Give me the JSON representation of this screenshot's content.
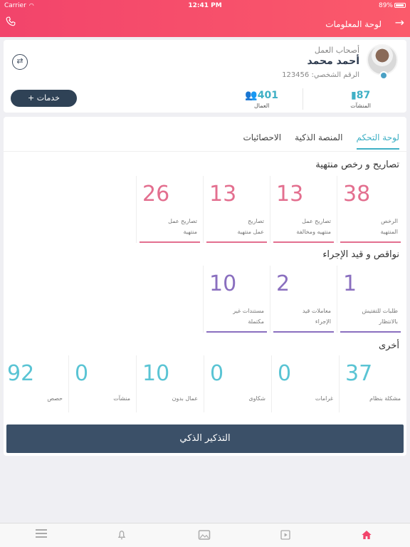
{
  "status_bar": {
    "carrier": "Carrier",
    "time": "12:41 PM",
    "battery": "89%"
  },
  "header": {
    "title": "لوحة المعلومات"
  },
  "profile": {
    "category": "أصحاب العمل",
    "name": "أحمد محمد",
    "national_id": "الرقم الشخصي: 123456",
    "establishments_count": "87",
    "establishments_label": "المنشآت",
    "workers_count": "401",
    "workers_label": "العمال",
    "services_button": "خدمات"
  },
  "tabs": {
    "dashboard": "لوحة التحكم",
    "smart_platform": "المنصة الذكية",
    "statistics": "الاحصائيات"
  },
  "section_expired": {
    "title": "تصاريح و رخص منتهية",
    "items": [
      {
        "value": "38",
        "label1": "الرخص",
        "label2": "المنتهية"
      },
      {
        "value": "13",
        "label1": "تصاريح عمل",
        "label2": "منتهيه ومخالفة"
      },
      {
        "value": "13",
        "label1": "تصاريح",
        "label2": "عمل منتهية"
      },
      {
        "value": "26",
        "label1": "تصاريح عمل",
        "label2": "منتهية"
      }
    ]
  },
  "section_pending": {
    "title": "نواقص و قيد الإجراء",
    "items": [
      {
        "value": "1",
        "label1": "طلبات للتفتيش",
        "label2": "بالانتظار"
      },
      {
        "value": "2",
        "label1": "معاملات قيد",
        "label2": "الإجراء"
      },
      {
        "value": "10",
        "label1": "مستندات غير",
        "label2": "مكتملة"
      }
    ]
  },
  "section_other": {
    "title": "أخرى",
    "items": [
      {
        "value": "37",
        "label": "مشكلة بنظام"
      },
      {
        "value": "0",
        "label": "غرامات"
      },
      {
        "value": "0",
        "label": "شكاوى"
      },
      {
        "value": "10",
        "label": "عمال بدون"
      },
      {
        "value": "0",
        "label": "منشآت"
      },
      {
        "value": "92",
        "label": "حصص"
      }
    ]
  },
  "smart_reminder_button": "التذكير الذكي",
  "colors": {
    "header": "#f2446b",
    "accent": "#3fb0c5",
    "pink": "#e36f8f",
    "purple": "#8a6fbf",
    "teal": "#5ac4d4",
    "button_dark": "#3b5068"
  },
  "bottom_tabs": [
    "menu-icon",
    "bell-icon",
    "gallery-icon",
    "video-icon",
    "home-icon"
  ]
}
